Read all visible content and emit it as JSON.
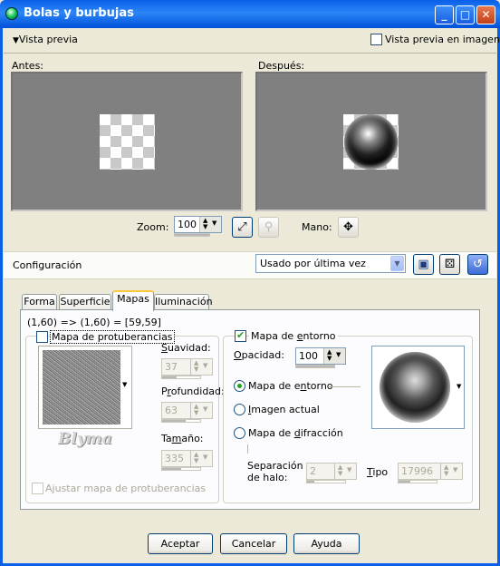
{
  "window": {
    "title": "Bolas y burbujas"
  },
  "preview": {
    "toggle_label": "Vista previa",
    "image_preview_label": "Vista previa en imagen",
    "before_label": "Antes:",
    "after_label": "Después:",
    "zoom_label": "Zoom:",
    "zoom_value": "100",
    "pan_label": "Mano:"
  },
  "config": {
    "label": "Configuración",
    "preset_value": "Usado por última vez"
  },
  "tabs": [
    "Forma",
    "Superficie",
    "Mapas",
    "Iluminación"
  ],
  "active_tab": "Mapas",
  "maps": {
    "coordinates": "(1,60) => (1,60) = [59,59]",
    "bump": {
      "checkbox_label": "Mapa de protuberancias",
      "checked": false,
      "watermark": "Blyma",
      "smoothness_label": "Suavidad:",
      "smoothness_value": "37",
      "smoothness_fill": 0.37,
      "depth_label": "Profundidad:",
      "depth_value": "63",
      "depth_fill": 0.63,
      "size_label": "Tamaño:",
      "size_value": "335",
      "size_fill": 0.5,
      "fit_label": "Ajustar mapa de protuberancias"
    },
    "env": {
      "checkbox_label": "Mapa de entorno",
      "checked": true,
      "opacity_label": "Opacidad:",
      "opacity_value": "100",
      "opacity_fill": 1.0,
      "radio_env": "Mapa de entorno",
      "radio_current": "Imagen actual",
      "radio_diffraction": "Mapa de difracción",
      "selected": "Mapa de entorno",
      "halo_label_1": "Separación",
      "halo_label_2": "de halo:",
      "halo_value": "2",
      "halo_fill": 0.2,
      "type_label": "Tipo",
      "type_value": "17996",
      "type_fill": 0.3
    }
  },
  "buttons": {
    "ok": "Aceptar",
    "cancel": "Cancelar",
    "help": "Ayuda"
  }
}
